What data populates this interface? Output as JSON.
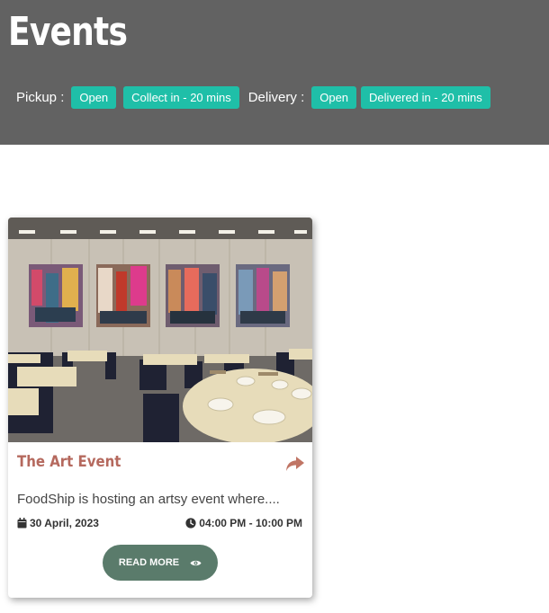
{
  "header": {
    "title": "Events",
    "pickup_label": "Pickup :",
    "pickup_status": "Open",
    "pickup_time": "Collect in - 20 mins",
    "delivery_label": "Delivery :",
    "delivery_status": "Open",
    "delivery_time": "Delivered in - 20 mins"
  },
  "event_card": {
    "title": "The Art Event",
    "description": "FoodShip is hosting an artsy event where....",
    "date": "30 April, 2023",
    "time": "04:00 PM - 10:00 PM",
    "read_more_label": "READ MORE"
  },
  "icons": {
    "calendar": "calendar-icon",
    "clock": "clock-icon",
    "share": "share-icon",
    "eye": "eye-icon"
  },
  "colors": {
    "header_bg": "#626262",
    "badge": "#1fbfa8",
    "event_title": "#b5695e",
    "button": "#5a7b6b"
  }
}
